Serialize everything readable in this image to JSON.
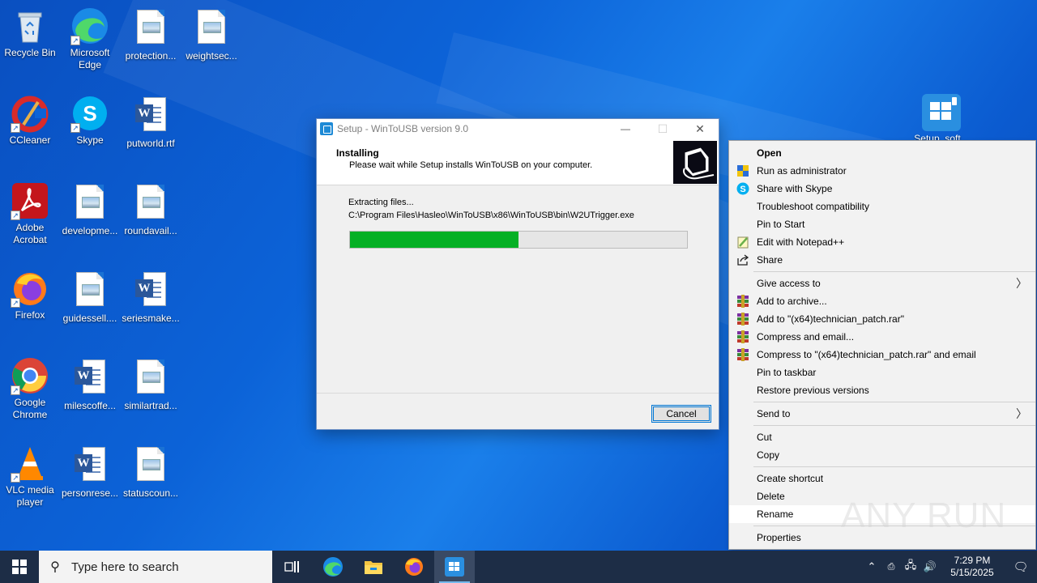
{
  "desktop_icons": [
    {
      "label": "Recycle Bin",
      "icon": "recycle-bin-icon"
    },
    {
      "label": "Microsoft Edge",
      "icon": "edge-icon"
    },
    {
      "label": "protection...",
      "icon": "image-file-icon"
    },
    {
      "label": "weightsec...",
      "icon": "image-file-icon"
    },
    {
      "label": "CCleaner",
      "icon": "ccleaner-icon"
    },
    {
      "label": "Skype",
      "icon": "skype-icon"
    },
    {
      "label": "putworld.rtf",
      "icon": "word-file-icon"
    },
    {
      "label": "Adobe Acrobat",
      "icon": "acrobat-icon"
    },
    {
      "label": "developme...",
      "icon": "image-file-icon"
    },
    {
      "label": "roundavail...",
      "icon": "image-file-icon"
    },
    {
      "label": "Firefox",
      "icon": "firefox-icon"
    },
    {
      "label": "guidessell....",
      "icon": "image-file-icon"
    },
    {
      "label": "seriesmake...",
      "icon": "word-file-icon"
    },
    {
      "label": "Google Chrome",
      "icon": "chrome-icon"
    },
    {
      "label": "milescoffe...",
      "icon": "word-file-icon"
    },
    {
      "label": "similartrad...",
      "icon": "image-file-icon"
    },
    {
      "label": "VLC media player",
      "icon": "vlc-icon"
    },
    {
      "label": "personrese...",
      "icon": "word-file-icon"
    },
    {
      "label": "statuscoun...",
      "icon": "image-file-icon"
    },
    {
      "label": "Setup_soft...",
      "icon": "setup-file-icon"
    }
  ],
  "setup_window": {
    "title": "Setup - WinToUSB version 9.0",
    "heading": "Installing",
    "subheading": "Please wait while Setup installs WinToUSB on your computer.",
    "status": "Extracting files...",
    "path": "C:\\Program Files\\Hasleo\\WinToUSB\\x86\\WinToUSB\\bin\\W2UTrigger.exe",
    "progress_fraction": 0.5,
    "cancel_label": "Cancel",
    "minimize_glyph": "—",
    "maximize_glyph": "☐",
    "close_glyph": "✕"
  },
  "context_menu": {
    "groups": [
      [
        {
          "label": "Open",
          "icon": "",
          "bold": true
        },
        {
          "label": "Run as administrator",
          "icon": "uac-shield-icon"
        },
        {
          "label": "Share with Skype",
          "icon": "skype-icon"
        },
        {
          "label": "Troubleshoot compatibility",
          "icon": ""
        },
        {
          "label": "Pin to Start",
          "icon": ""
        },
        {
          "label": "Edit with Notepad++",
          "icon": "notepadpp-icon"
        },
        {
          "label": "Share",
          "icon": "share-icon"
        }
      ],
      [
        {
          "label": "Give access to",
          "icon": "",
          "submenu": true
        },
        {
          "label": "Add to archive...",
          "icon": "winrar-icon"
        },
        {
          "label": "Add to \"(x64)technician_patch.rar\"",
          "icon": "winrar-icon"
        },
        {
          "label": "Compress and email...",
          "icon": "winrar-icon"
        },
        {
          "label": "Compress to \"(x64)technician_patch.rar\" and email",
          "icon": "winrar-icon"
        },
        {
          "label": "Pin to taskbar",
          "icon": ""
        },
        {
          "label": "Restore previous versions",
          "icon": ""
        }
      ],
      [
        {
          "label": "Send to",
          "icon": "",
          "submenu": true
        }
      ],
      [
        {
          "label": "Cut",
          "icon": ""
        },
        {
          "label": "Copy",
          "icon": ""
        }
      ],
      [
        {
          "label": "Create shortcut",
          "icon": ""
        },
        {
          "label": "Delete",
          "icon": ""
        },
        {
          "label": "Rename",
          "icon": "",
          "highlighted": true
        }
      ],
      [
        {
          "label": "Properties",
          "icon": ""
        }
      ]
    ],
    "submenu_glyph": "〉"
  },
  "taskbar": {
    "search_placeholder": "Type here to search",
    "apps": [
      {
        "name": "task-view-icon"
      },
      {
        "name": "edge-icon"
      },
      {
        "name": "file-explorer-icon"
      },
      {
        "name": "firefox-icon"
      },
      {
        "name": "wintousb-setup-icon",
        "active": true
      }
    ],
    "time": "7:29 PM",
    "date": "5/15/2025",
    "tray_glyphs": {
      "chevron": "⌃",
      "network": "🖧",
      "volume": "🔊",
      "notification": "🗨"
    }
  },
  "watermark": "ANY RUN",
  "colors": {
    "progress": "#06b025",
    "taskbar": "#1d2d46",
    "desktop": "#0c63d8",
    "focus": "#0078d7"
  }
}
